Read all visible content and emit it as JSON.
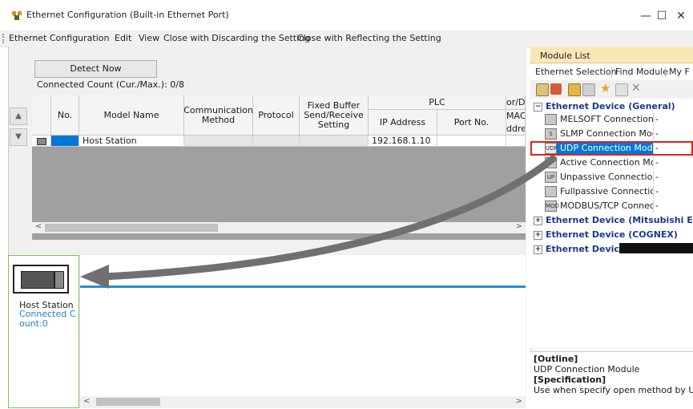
{
  "window": {
    "title": "Ethernet Configuration (Built-in Ethernet Port)",
    "minimize": "—",
    "maximize": "☐",
    "close": "✕"
  },
  "menu": [
    "Ethernet Configuration",
    "Edit",
    "View",
    "Close with Discarding the Setting",
    "Close with Reflecting the Setting"
  ],
  "detect_button": "Detect Now",
  "connected_count": "Connected Count (Cur./Max.): 0/8",
  "table": {
    "headers": {
      "no": "No.",
      "model_name": "Model Name",
      "communication_method": "Communication Method",
      "protocol": "Protocol",
      "fixed_buffer": "Fixed Buffer Send/Receive Setting",
      "plc": "PLC",
      "ip_address": "IP Address",
      "port_no": "Port No.",
      "mac_top": "or/D",
      "mac_mid": "MAC",
      "mac_bottom": "ddre"
    },
    "rows": [
      {
        "model_name": "Host Station",
        "ip_address": "192.168.1.10"
      }
    ]
  },
  "host_station": {
    "name": "Host Station",
    "count": "Connected Count:0"
  },
  "module_list": {
    "title": "Module List",
    "tabs": [
      "Ethernet Selection",
      "Find Module",
      "My F"
    ],
    "tree": [
      {
        "label": "Ethernet Device (General)",
        "expanded": true,
        "children": [
          {
            "label": "MELSOFT Connection M",
            "value": "-",
            "icon": "melsoft-icon"
          },
          {
            "label": "SLMP Connection Modu",
            "value": "-",
            "icon": "slmp-icon"
          },
          {
            "label": "UDP Connection Module",
            "value": "-",
            "icon": "udp-icon",
            "selected": true
          },
          {
            "label": "Active Connection Modu",
            "value": "-",
            "icon": "active-icon"
          },
          {
            "label": "Unpassive Connection M",
            "value": "-",
            "icon": "unpassive-icon"
          },
          {
            "label": "Fullpassive Connection",
            "value": "-",
            "icon": "fullpassive-icon"
          },
          {
            "label": "MODBUS/TCP Connecti",
            "value": "-",
            "icon": "modbus-icon"
          }
        ]
      },
      {
        "label": "Ethernet Device (Mitsubishi Elect",
        "expanded": false
      },
      {
        "label": "Ethernet Device (COGNEX)",
        "expanded": false
      },
      {
        "label": "Ethernet Device",
        "expanded": false
      }
    ]
  },
  "outline": {
    "outline_label": "[Outline]",
    "outline_text": "UDP Connection Module",
    "spec_label": "[Specification]",
    "spec_text": "Use when specify open method by UDP"
  },
  "colors": {
    "accent_blue": "#0078d7",
    "network_line": "#2a8ed6",
    "highlight_red": "#e02020",
    "module_header": "#fbe7b6",
    "drag_arrow": "#707070"
  }
}
